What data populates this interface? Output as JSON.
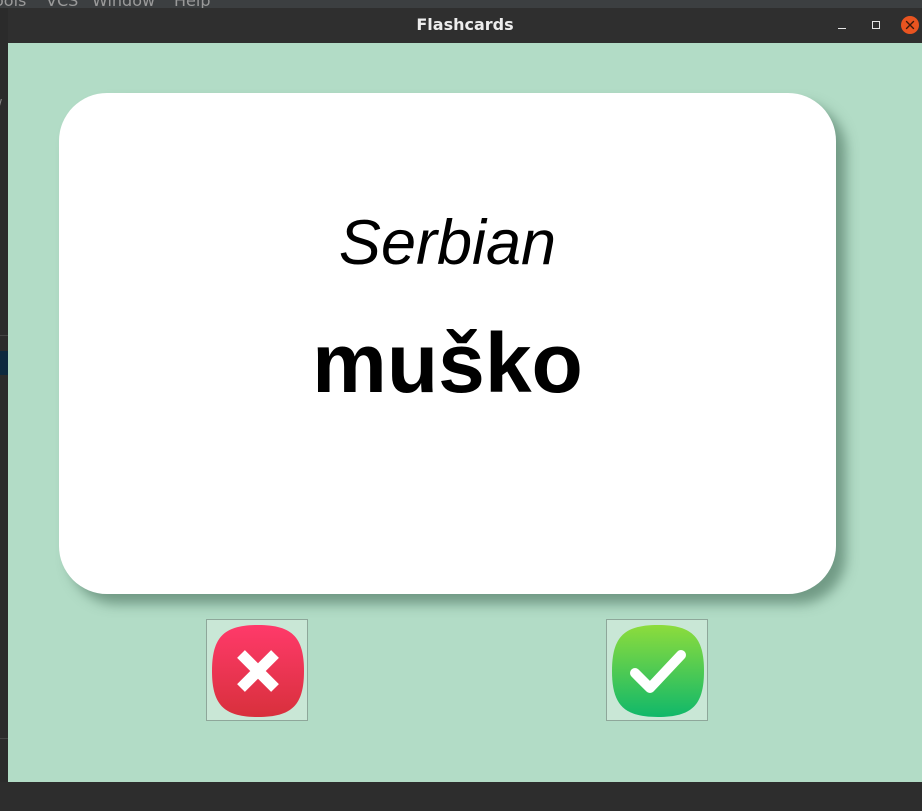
{
  "background_app": {
    "menu_items": [
      "ools",
      "VCS",
      "Window",
      "Help"
    ]
  },
  "window": {
    "title": "Flashcards",
    "controls": [
      "minimize-icon",
      "maximize-icon",
      "close-icon"
    ]
  },
  "card": {
    "language": "Serbian",
    "word": "muško"
  },
  "buttons": {
    "wrong": {
      "icon": "cross-icon",
      "color": "#e8334f"
    },
    "right": {
      "icon": "checkmark-icon",
      "color": "#2cc24d"
    }
  },
  "colors": {
    "window_background": "#b2dcc6",
    "titlebar": "#2f2f2f",
    "close_button": "#e95420"
  }
}
